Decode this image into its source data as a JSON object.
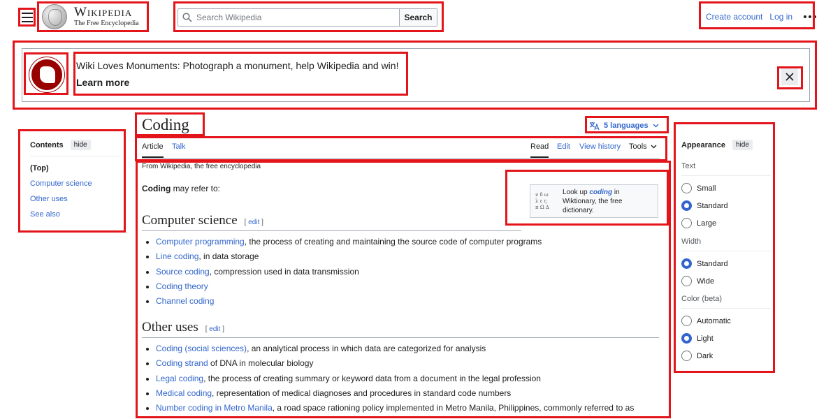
{
  "header": {
    "logo_title": "Wikipedia",
    "logo_tagline": "The Free Encyclopedia",
    "search_placeholder": "Search Wikipedia",
    "search_button": "Search",
    "create_account": "Create account",
    "log_in": "Log in"
  },
  "banner": {
    "message": "Wiki Loves Monuments: Photograph a monument, help Wikipedia and win!",
    "cta": "Learn more"
  },
  "toc": {
    "title": "Contents",
    "hide": "hide",
    "items": [
      "(Top)",
      "Computer science",
      "Other uses",
      "See also"
    ]
  },
  "page": {
    "title": "Coding",
    "languages": "5 languages",
    "tabs": {
      "article": "Article",
      "talk": "Talk",
      "read": "Read",
      "edit": "Edit",
      "history": "View history",
      "tools": "Tools"
    },
    "from": "From Wikipedia, the free encyclopedia",
    "intro_bold": "Coding",
    "intro_rest": " may refer to:",
    "wiktionary": {
      "pre": "Look up ",
      "term": "coding",
      "post": " in Wiktionary, the free dictionary.",
      "logo": "ν δ ω\nλ ε ς\nπ Ω ∆"
    },
    "edit_label": "edit"
  },
  "sections": {
    "cs": {
      "title": "Computer science",
      "items": [
        {
          "link": "Computer programming",
          "text": ", the process of creating and maintaining the source code of computer programs"
        },
        {
          "link": "Line coding",
          "text": ", in data storage"
        },
        {
          "link": "Source coding",
          "text": ", compression used in data transmission"
        },
        {
          "link": "Coding theory",
          "text": ""
        },
        {
          "link": "Channel coding",
          "text": ""
        }
      ]
    },
    "other": {
      "title": "Other uses",
      "items": [
        {
          "link": "Coding (social sciences)",
          "text": ", an analytical process in which data are categorized for analysis"
        },
        {
          "link": "Coding strand",
          "text": " of DNA in molecular biology"
        },
        {
          "link": "Legal coding",
          "text": ", the process of creating summary or keyword data from a document in the legal profession"
        },
        {
          "link": "Medical coding",
          "text": ", representation of medical diagnoses and procedures in standard code numbers"
        },
        {
          "link": "Number coding in Metro Manila",
          "text": ", a road space rationing policy implemented in Metro Manila, Philippines, commonly referred to as"
        }
      ]
    }
  },
  "appearance": {
    "title": "Appearance",
    "hide": "hide",
    "text": {
      "label": "Text",
      "options": [
        "Small",
        "Standard",
        "Large"
      ],
      "selected": 1
    },
    "width": {
      "label": "Width",
      "options": [
        "Standard",
        "Wide"
      ],
      "selected": 0
    },
    "color": {
      "label": "Color (beta)",
      "options": [
        "Automatic",
        "Light",
        "Dark"
      ],
      "selected": 1
    }
  },
  "colors": {
    "link": "#3366cc",
    "highlight": "#e3151a",
    "banner_logo": "#990000"
  }
}
